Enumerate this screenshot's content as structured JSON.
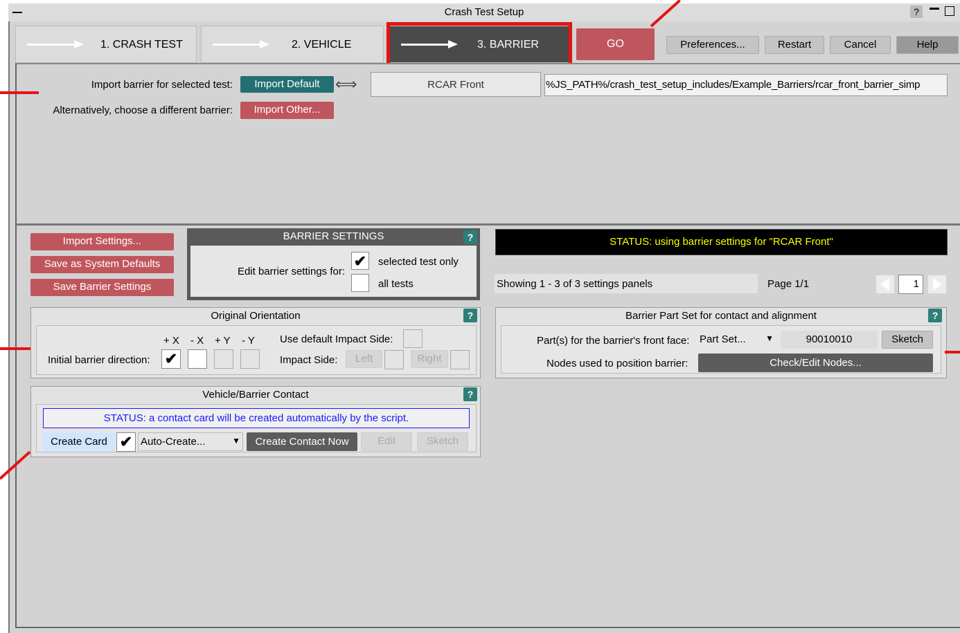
{
  "window": {
    "title": "Crash Test Setup",
    "controls": "?"
  },
  "tabs": [
    {
      "label": "1. CRASH TEST"
    },
    {
      "label": "2. VEHICLE"
    },
    {
      "label": "3. BARRIER"
    }
  ],
  "toolbar": {
    "go": "GO",
    "preferences": "Preferences...",
    "restart": "Restart",
    "cancel": "Cancel",
    "help": "Help"
  },
  "import": {
    "selected_label": "Import barrier for selected test:",
    "default_btn": "Import Default",
    "barrier_name": "RCAR Front",
    "path": "%JS_PATH%/crash_test_setup_includes/Example_Barriers/rcar_front_barrier_simp",
    "alt_label": "Alternatively, choose a different barrier:",
    "other_btn": "Import Other..."
  },
  "left_buttons": {
    "import_settings": "Import Settings...",
    "save_defaults": "Save as System Defaults",
    "save_barrier": "Save Barrier Settings"
  },
  "barrier_settings": {
    "title": "BARRIER SETTINGS",
    "help": "?",
    "edit_label": "Edit barrier settings for:",
    "opt_selected": "selected test only",
    "opt_all": "all tests",
    "selected_check": "✔"
  },
  "status": {
    "text": "STATUS: using barrier settings for \"RCAR Front\"",
    "color": "#ffff00"
  },
  "paging": {
    "showing": "Showing 1 - 3 of 3 settings panels",
    "page": "Page 1/1",
    "page_input": "1"
  },
  "orientation": {
    "title": "Original Orientation",
    "help": "?",
    "dirs": [
      "+ X",
      "- X",
      "+ Y",
      "- Y"
    ],
    "initial_label": "Initial barrier direction:",
    "check": "✔",
    "use_default_label": "Use default Impact Side:",
    "impact_label": "Impact Side:",
    "left": "Left",
    "right": "Right"
  },
  "part_set": {
    "title": "Barrier Part Set for contact and alignment",
    "help": "?",
    "front_face_label": "Part(s) for the barrier's front face:",
    "type_value": "Part Set...",
    "id_value": "90010010",
    "sketch": "Sketch",
    "nodes_label": "Nodes used to position barrier:",
    "nodes_btn": "Check/Edit Nodes..."
  },
  "contact": {
    "title": "Vehicle/Barrier Contact",
    "help": "?",
    "status": "STATUS: a contact card will be created automatically by the script.",
    "create_card": "Create Card",
    "check": "✔",
    "mode_value": "Auto-Create...",
    "create_now": "Create Contact Now",
    "edit": "Edit",
    "sketch": "Sketch"
  }
}
